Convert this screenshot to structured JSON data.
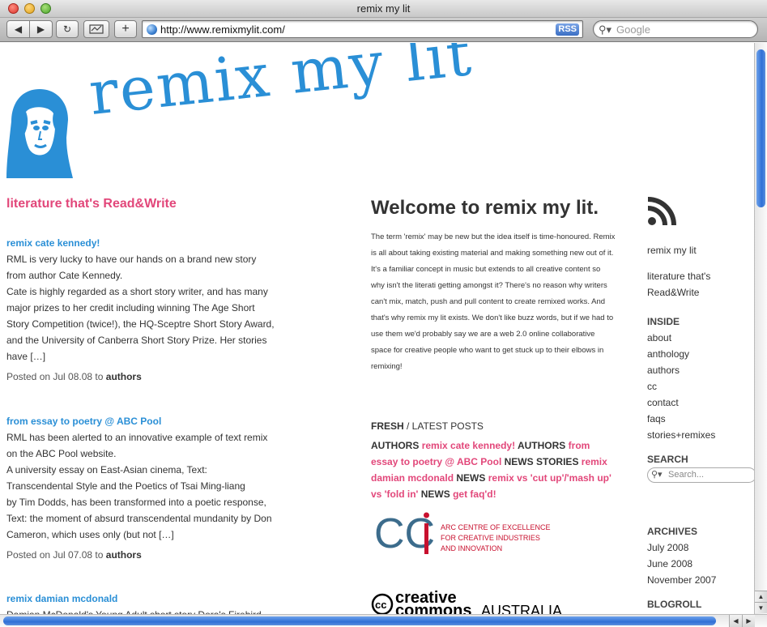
{
  "window": {
    "title": "remix my lit"
  },
  "toolbar": {
    "url": "http://www.remixmylit.com/",
    "rss_label": "RSS",
    "search_placeholder": "Google",
    "add_label": "+"
  },
  "site": {
    "logo_text": "remix my lit",
    "tagline": "literature that's Read&Write"
  },
  "posts": [
    {
      "title": "remix cate kennedy!",
      "body": [
        "RML is very lucky to have our hands on a brand new story",
        "from author Cate Kennedy.",
        "Cate is highly regarded as a short story writer, and has many",
        "major prizes to her credit including winning The Age Short",
        "Story Competition (twice!), the HQ-Sceptre Short Story Award,",
        "and the University of Canberra Short Story Prize. Her stories",
        "have […]"
      ],
      "meta_prefix": "Posted on Jul 08.08 to",
      "category": "authors"
    },
    {
      "title": "from essay to poetry @ ABC Pool",
      "body": [
        "RML has been alerted to an innovative example of text remix",
        "on the ABC Pool website.",
        "A university essay on East-Asian cinema, Text:",
        "Transcendental Style and the Poetics of Tsai Ming-liang",
        "by Tim Dodds, has been transformed into a poetic response,",
        "Text: the moment of absurd transcendental mundanity by Don",
        "Cameron, which uses only (but not […]"
      ],
      "meta_prefix": "Posted on Jul 07.08 to",
      "category": "authors"
    },
    {
      "title": "remix damian mcdonald",
      "body": [
        "Damian McDonald's Young Adult short story Dora's Firebird"
      ]
    }
  ],
  "welcome": {
    "heading": "Welcome to remix my lit.",
    "text": "The term 'remix' may be new but the idea itself is time-honoured. Remix is all about taking existing material and making something new out of it. It's a familiar concept in music but extends to all creative content so why isn't the literati getting amongst it? There's no reason why writers can't mix, match, push and pull content to create remixed works. And that's why remix my lit exists. We don't like buzz words, but if we had to use them we'd probably say we are a web 2.0 online collaborative space for creative people who want to get stuck up to their elbows in remixing!"
  },
  "fresh": {
    "heading_bold": "FRESH",
    "heading_rest": " / LATEST POSTS",
    "items": [
      {
        "cat": "AUTHORS",
        "link": "remix cate kennedy!"
      },
      {
        "cat": "AUTHORS",
        "link": "from essay to poetry @ ABC Pool"
      },
      {
        "cat": "NEWS",
        "link": ""
      },
      {
        "cat": "STORIES",
        "link": "remix damian mcdonald"
      },
      {
        "cat": "NEWS",
        "link": "remix vs 'cut up'/'mash up' vs 'fold in'"
      },
      {
        "cat": "NEWS",
        "link": "get faq'd!"
      }
    ]
  },
  "cci": {
    "line1": "ARC CENTRE OF EXCELLENCE",
    "line2": "FOR CREATIVE INDUSTRIES",
    "line3": "AND INNOVATION"
  },
  "cc_logo": {
    "word1": "creative",
    "word2": "commons",
    "word3": "AUSTRALIA"
  },
  "sidebar": {
    "site_name": "remix my lit",
    "tagline_1": "literature that's",
    "tagline_2": "Read&Write",
    "inside_heading": "INSIDE",
    "inside_links": [
      "about",
      "anthology",
      "authors",
      "cc",
      "contact",
      "faqs",
      "stories+remixes"
    ],
    "search_heading": "SEARCH",
    "search_placeholder": "Search...",
    "archives_heading": "ARCHIVES",
    "archives": [
      "July 2008",
      "June 2008",
      "November 2007"
    ],
    "blogroll_heading": "BLOGROLL"
  },
  "colors": {
    "accent_pink": "#e2477a",
    "accent_blue": "#2a8fd6"
  }
}
